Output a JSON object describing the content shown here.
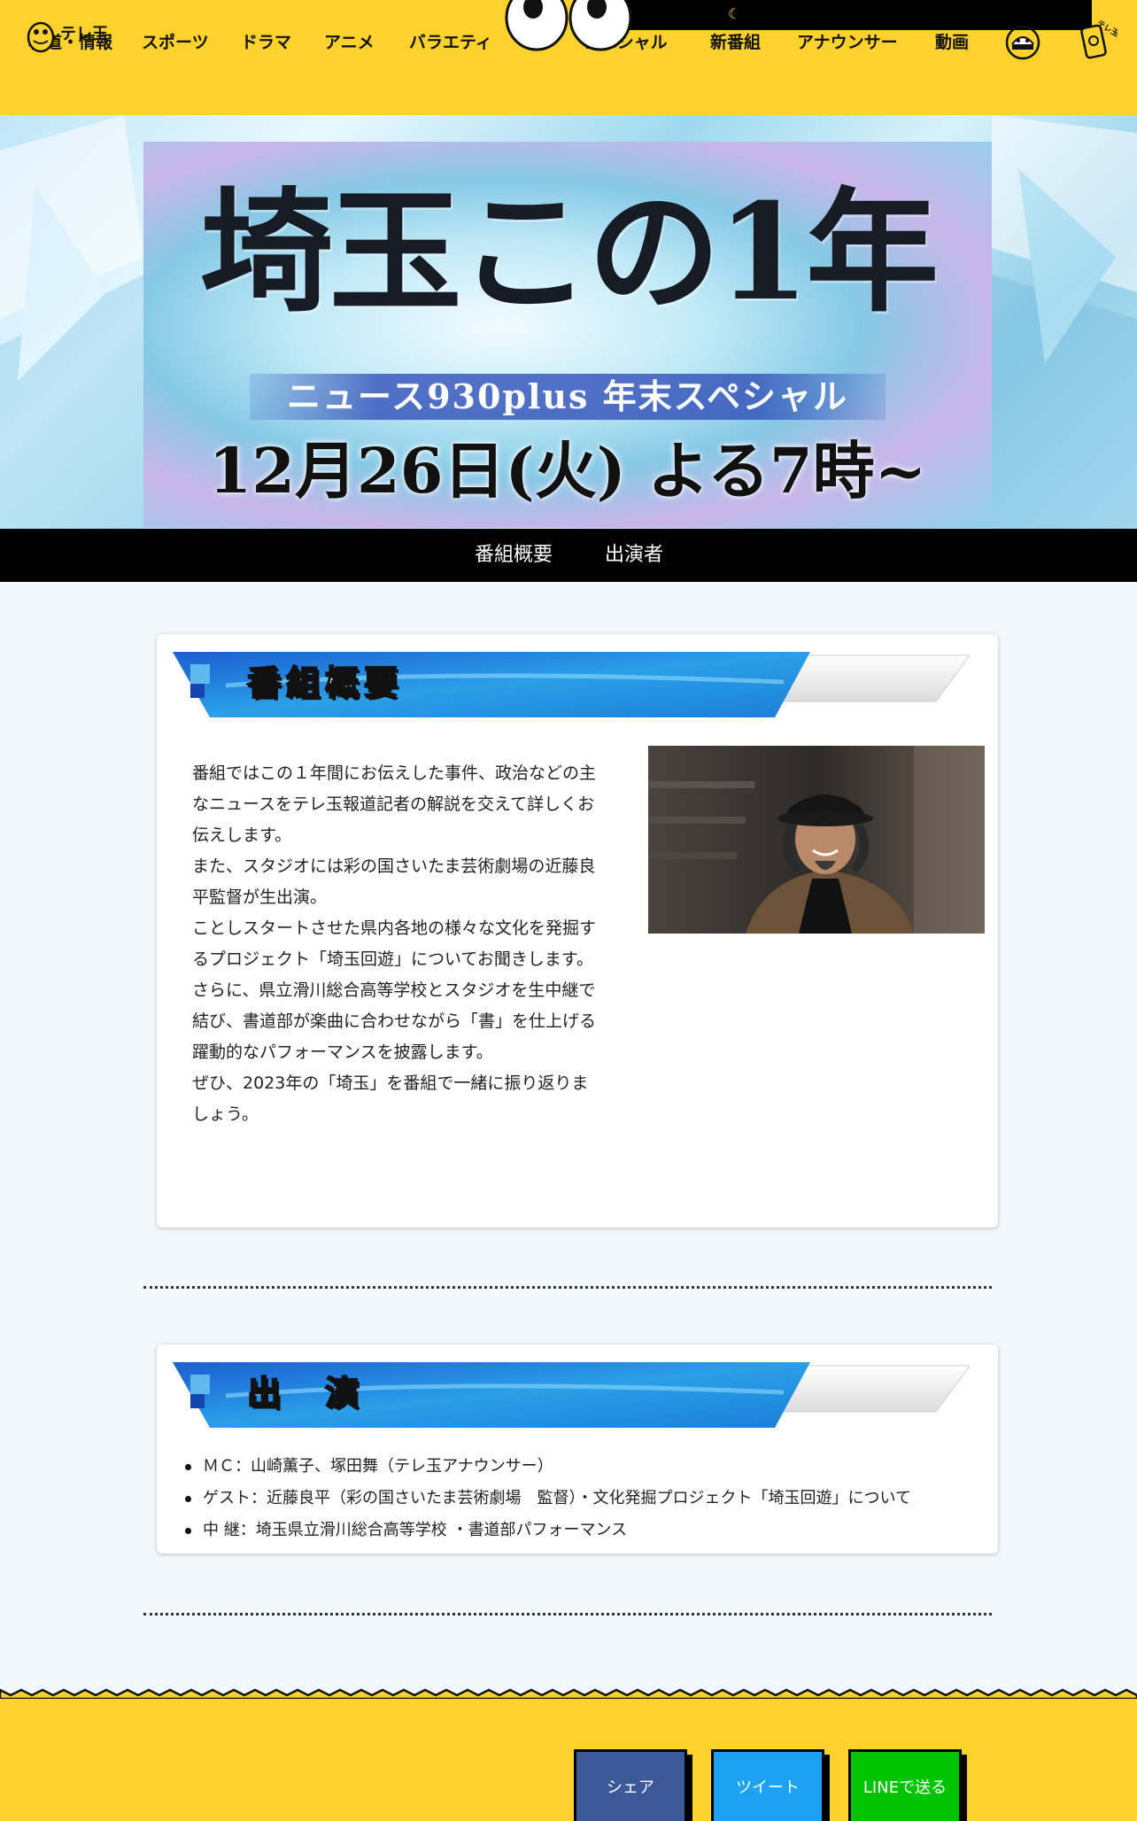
{
  "header": {
    "logo_text": "テレ玉",
    "nav": [
      "報道・情報",
      "スポーツ",
      "ドラマ",
      "アニメ",
      "バラエティ",
      "スペシャル",
      "新番組",
      "アナウンサー",
      "動画"
    ],
    "nav_hidden_fragment": "ス",
    "icons": [
      "egg-mascot-icon",
      "mobile-icon"
    ],
    "mobile_label": "テレ玉モバイル"
  },
  "hero": {
    "title": "埼玉この1年",
    "subtitle": "ニュース930plus 年末スペシャル",
    "date": "12月26日(火) よる7時~"
  },
  "anchor_nav": {
    "items": [
      "番組概要",
      "出演者"
    ]
  },
  "overview": {
    "heading": "番組概要",
    "paragraphs": [
      "番組ではこの１年間にお伝えした事件、政治などの主なニュースをテレ玉報道記者の解説を交えて詳しくお伝えします。",
      "また、スタジオには彩の国さいたま芸術劇場の近藤良平監督が生出演。",
      "ことしスタートさせた県内各地の様々な文化を発掘するプロジェクト「埼玉回遊」についてお聞きします。",
      "さらに、県立滑川総合高等学校とスタジオを生中継で結び、書道部が楽曲に合わせながら「書」を仕上げる躍動的なパフォーマンスを披露します。",
      "ぜひ、2023年の「埼玉」を番組で一緒に振り返りましょう。"
    ]
  },
  "cast": {
    "heading": "出　演",
    "items": [
      "ＭＣ：山崎薫子、塚田舞（テレ玉アナウンサー）",
      "ゲスト：近藤良平（彩の国さいたま芸術劇場　監督）・文化発掘プロジェクト「埼玉回遊」について",
      "中 継：埼玉県立滑川総合高等学校 ・書道部パフォーマンス"
    ]
  },
  "share": {
    "facebook": "シェア",
    "twitter": "ツイート",
    "line": "LINEで送る"
  },
  "colors": {
    "brand_yellow": "#fdd22c",
    "share_facebook": "#3b5998",
    "share_twitter": "#1da1f2",
    "share_line": "#00c300"
  }
}
